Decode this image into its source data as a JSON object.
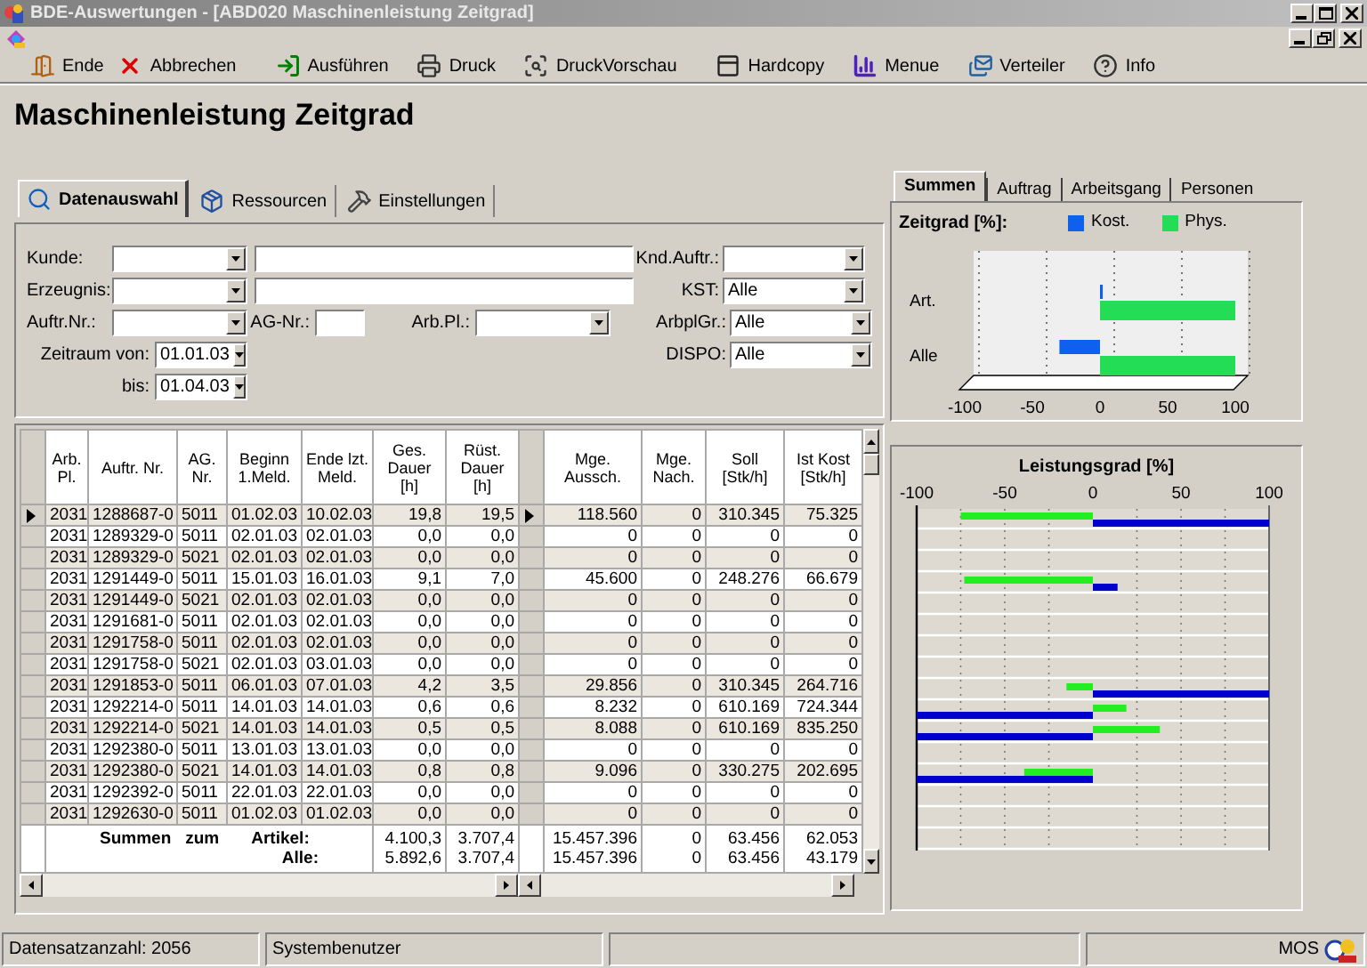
{
  "window": {
    "title": "BDE-Auswertungen - [ABD020 Maschinenleistung Zeitgrad]"
  },
  "toolbar": [
    {
      "kind": "exit",
      "label": "Ende"
    },
    {
      "kind": "cancel",
      "label": "Abbrechen"
    },
    {
      "kind": "run",
      "label": "Ausführen"
    },
    {
      "kind": "print",
      "label": "Druck"
    },
    {
      "kind": "preview",
      "label": "DruckVorschau"
    },
    {
      "kind": "hardcopy",
      "label": "Hardcopy"
    },
    {
      "kind": "menu",
      "label": "Menue"
    },
    {
      "kind": "distribute",
      "label": "Verteiler"
    },
    {
      "kind": "info",
      "label": "Info"
    }
  ],
  "heading": "Maschinenleistung Zeitgrad",
  "left_tabs": [
    {
      "kind": "search",
      "label": "Datenauswahl",
      "selected": true
    },
    {
      "kind": "resources",
      "label": "Ressourcen",
      "selected": false
    },
    {
      "kind": "settings",
      "label": "Einstellungen",
      "selected": false
    }
  ],
  "form": {
    "kunde": {
      "label": "Kunde:"
    },
    "erzeugnis": {
      "label": "Erzeugnis:"
    },
    "auftr_nr": {
      "label": "Auftr.Nr.:"
    },
    "ag_nr": {
      "label": "AG-Nr.:"
    },
    "arb_pl": {
      "label": "Arb.Pl.:"
    },
    "zeitraum_von": {
      "label": "Zeitraum von:",
      "value": "01.01.03"
    },
    "bis": {
      "label": "bis:",
      "value": "01.04.03"
    },
    "knd_auftr": {
      "label": "Knd.Auftr.:"
    },
    "kst": {
      "label": "KST:",
      "value": "Alle"
    },
    "arbplgr": {
      "label": "ArbplGr.:",
      "value": "Alle"
    },
    "dispo": {
      "label": "DISPO:",
      "value": "Alle"
    }
  },
  "table": {
    "left_columns": [
      "Arb.\nPl.",
      "Auftr. Nr.",
      "AG.\nNr.",
      "Beginn\n1.Meld.",
      "Ende lzt.\nMeld.",
      "Ges.\nDauer\n[h]",
      "Rüst.\nDauer\n[h]"
    ],
    "right_columns": [
      "Mge.\nAussch.",
      "Mge.\nNach.",
      "Soll\n[Stk/h]",
      "Ist Kost\n[Stk/h]"
    ],
    "rows": [
      {
        "selected": true,
        "cells": [
          "2031",
          "1288687-0",
          "5011",
          "01.02.03",
          "10.02.03",
          "19,8",
          "19,5",
          "118.560",
          "0",
          "310.345",
          "75.325"
        ]
      },
      {
        "selected": false,
        "cells": [
          "2031",
          "1289329-0",
          "5011",
          "02.01.03",
          "02.01.03",
          "0,0",
          "0,0",
          "0",
          "0",
          "0",
          "0"
        ]
      },
      {
        "selected": false,
        "cells": [
          "2031",
          "1289329-0",
          "5021",
          "02.01.03",
          "02.01.03",
          "0,0",
          "0,0",
          "0",
          "0",
          "0",
          "0"
        ]
      },
      {
        "selected": false,
        "cells": [
          "2031",
          "1291449-0",
          "5011",
          "15.01.03",
          "16.01.03",
          "9,1",
          "7,0",
          "45.600",
          "0",
          "248.276",
          "66.679"
        ]
      },
      {
        "selected": false,
        "cells": [
          "2031",
          "1291449-0",
          "5021",
          "02.01.03",
          "02.01.03",
          "0,0",
          "0,0",
          "0",
          "0",
          "0",
          "0"
        ]
      },
      {
        "selected": false,
        "cells": [
          "2031",
          "1291681-0",
          "5011",
          "02.01.03",
          "02.01.03",
          "0,0",
          "0,0",
          "0",
          "0",
          "0",
          "0"
        ]
      },
      {
        "selected": false,
        "cells": [
          "2031",
          "1291758-0",
          "5011",
          "02.01.03",
          "02.01.03",
          "0,0",
          "0,0",
          "0",
          "0",
          "0",
          "0"
        ]
      },
      {
        "selected": false,
        "cells": [
          "2031",
          "1291758-0",
          "5021",
          "02.01.03",
          "03.01.03",
          "0,0",
          "0,0",
          "0",
          "0",
          "0",
          "0"
        ]
      },
      {
        "selected": false,
        "cells": [
          "2031",
          "1291853-0",
          "5011",
          "06.01.03",
          "07.01.03",
          "4,2",
          "3,5",
          "29.856",
          "0",
          "310.345",
          "264.716"
        ]
      },
      {
        "selected": false,
        "cells": [
          "2031",
          "1292214-0",
          "5011",
          "14.01.03",
          "14.01.03",
          "0,6",
          "0,6",
          "8.232",
          "0",
          "610.169",
          "724.344"
        ]
      },
      {
        "selected": false,
        "cells": [
          "2031",
          "1292214-0",
          "5021",
          "14.01.03",
          "14.01.03",
          "0,5",
          "0,5",
          "8.088",
          "0",
          "610.169",
          "835.250"
        ]
      },
      {
        "selected": false,
        "cells": [
          "2031",
          "1292380-0",
          "5011",
          "13.01.03",
          "13.01.03",
          "0,0",
          "0,0",
          "0",
          "0",
          "0",
          "0"
        ]
      },
      {
        "selected": false,
        "cells": [
          "2031",
          "1292380-0",
          "5021",
          "14.01.03",
          "14.01.03",
          "0,8",
          "0,8",
          "9.096",
          "0",
          "330.275",
          "202.695"
        ]
      },
      {
        "selected": false,
        "cells": [
          "2031",
          "1292392-0",
          "5011",
          "22.01.03",
          "22.01.03",
          "0,0",
          "0,0",
          "0",
          "0",
          "0",
          "0"
        ]
      },
      {
        "selected": false,
        "cells": [
          "2031",
          "1292630-0",
          "5011",
          "01.02.03",
          "01.02.03",
          "0,0",
          "0,0",
          "0",
          "0",
          "0",
          "0"
        ]
      }
    ],
    "totals": {
      "labels": [
        "Summen",
        "zum",
        "Artikel:"
      ],
      "second_label": "Alle:",
      "rows": [
        [
          "4.100,3",
          "3.707,4",
          "15.457.396",
          "0",
          "63.456",
          "62.053"
        ],
        [
          "5.892,6",
          "3.707,4",
          "15.457.396",
          "0",
          "63.456",
          "43.179"
        ]
      ]
    }
  },
  "right_tabs": [
    {
      "label": "Summen",
      "selected": true
    },
    {
      "label": "Auftrag",
      "selected": false
    },
    {
      "label": "Arbeitsgang",
      "selected": false
    },
    {
      "label": "Personen",
      "selected": false
    }
  ],
  "summary_chart": {
    "chart_data": {
      "type": "bar",
      "orientation": "horizontal",
      "title": "Zeitgrad [%]:",
      "categories": [
        "Art.",
        "Alle"
      ],
      "xticks": [
        -100,
        -50,
        0,
        50,
        100
      ],
      "xlim": [
        -100,
        100
      ],
      "series": [
        {
          "name": "Kost.",
          "color": "#1060f0",
          "values": [
            2,
            -30
          ]
        },
        {
          "name": "Phys.",
          "color": "#22dd55",
          "values": [
            100,
            100
          ]
        }
      ]
    }
  },
  "performance_chart": {
    "chart_data": {
      "type": "bar",
      "orientation": "horizontal",
      "title": "Leistungsgrad [%]",
      "xticks": [
        -100,
        -50,
        0,
        50,
        100
      ],
      "xlim": [
        -100,
        100
      ],
      "grid": true,
      "series": [
        {
          "color": "#0000cc",
          "values": [
            100,
            0,
            0,
            14,
            0,
            0,
            0,
            0,
            100,
            -100,
            -100,
            0,
            -100,
            0,
            0,
            null
          ]
        },
        {
          "color": "#22ee22",
          "values": [
            -75,
            0,
            0,
            -73,
            0,
            0,
            0,
            0,
            -15,
            19,
            38,
            0,
            -39,
            0,
            0,
            null
          ]
        }
      ]
    }
  },
  "status_bar": {
    "count": "Datensatzanzahl: 2056",
    "user": "Systembenutzer",
    "app": "MOS"
  }
}
